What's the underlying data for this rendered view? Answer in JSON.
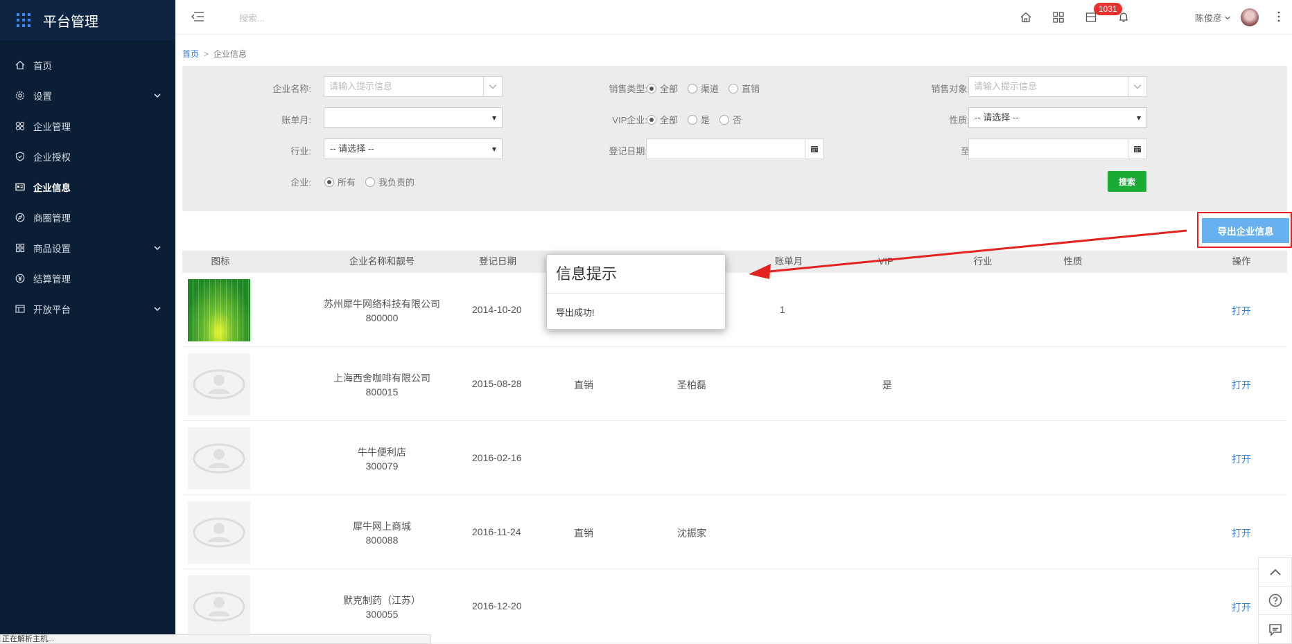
{
  "app": {
    "title": "平台管理"
  },
  "sidebar": {
    "items": [
      {
        "label": "首页",
        "icon": "home-icon"
      },
      {
        "label": "设置",
        "icon": "gear-icon",
        "expandable": true
      },
      {
        "label": "企业管理",
        "icon": "grid-icon"
      },
      {
        "label": "企业授权",
        "icon": "shield-icon"
      },
      {
        "label": "企业信息",
        "icon": "id-card-icon",
        "active": true
      },
      {
        "label": "商圈管理",
        "icon": "compass-icon"
      },
      {
        "label": "商品设置",
        "icon": "apps-icon",
        "expandable": true
      },
      {
        "label": "结算管理",
        "icon": "yen-icon"
      },
      {
        "label": "开放平台",
        "icon": "panel-icon",
        "expandable": true
      }
    ]
  },
  "topbar": {
    "search_placeholder": "搜索...",
    "badge_count": "1031",
    "user_name": "陈俊彦"
  },
  "breadcrumb": {
    "home": "首页",
    "separator": ">",
    "current": "企业信息"
  },
  "filters": {
    "company_name_label": "企业名称:",
    "company_name_placeholder": "请输入提示信息",
    "sales_type_label": "销售类型:",
    "sales_type_options": [
      "全部",
      "渠道",
      "直销"
    ],
    "sales_target_label": "销售对象:",
    "sales_target_placeholder": "请输入提示信息",
    "bill_month_label": "账单月:",
    "bill_month_value": "",
    "vip_label": "VIP企业:",
    "vip_options": [
      "全部",
      "是",
      "否"
    ],
    "nature_label": "性质:",
    "nature_value": "-- 请选择 --",
    "industry_label": "行业:",
    "industry_value": "-- 请选择 --",
    "reg_date_label": "登记日期:",
    "to_label": "至",
    "enterprise_label": "企业:",
    "enterprise_options": [
      "所有",
      "我负责的"
    ],
    "search_button": "搜索"
  },
  "export_button": "导出企业信息",
  "table": {
    "headers": [
      "图标",
      "企业名称和靓号",
      "登记日期",
      "",
      "",
      "账单月",
      "VIP",
      "行业",
      "性质",
      "操作"
    ],
    "rows": [
      {
        "name": "苏州犀牛网络科技有限公司",
        "code": "800000",
        "date": "2014-10-20",
        "sales_type": "",
        "sales_target": "",
        "bill_month": "1",
        "vip": "",
        "action": "打开",
        "thumb": "green"
      },
      {
        "name": "上海西舍咖啡有限公司",
        "code": "800015",
        "date": "2015-08-28",
        "sales_type": "直销",
        "sales_target": "圣柏磊",
        "bill_month": "",
        "vip": "是",
        "action": "打开",
        "thumb": "placeholder"
      },
      {
        "name": "牛牛便利店",
        "code": "300079",
        "date": "2016-02-16",
        "sales_type": "",
        "sales_target": "",
        "bill_month": "",
        "vip": "",
        "action": "打开",
        "thumb": "placeholder"
      },
      {
        "name": "犀牛网上商城",
        "code": "800088",
        "date": "2016-11-24",
        "sales_type": "直销",
        "sales_target": "沈振家",
        "bill_month": "",
        "vip": "",
        "action": "打开",
        "thumb": "placeholder"
      },
      {
        "name": "默克制药（江苏）",
        "code": "300055",
        "date": "2016-12-20",
        "sales_type": "",
        "sales_target": "",
        "bill_month": "",
        "vip": "",
        "action": "打开",
        "thumb": "placeholder"
      }
    ]
  },
  "modal": {
    "title": "信息提示",
    "message": "导出成功!"
  },
  "statusbar": "正在解析主机...",
  "colors": {
    "sidebar": "#0a1e36",
    "accent": "#2f7bd6",
    "search_green": "#1aab35",
    "export_blue": "#67b1f1",
    "highlight_red": "#e3231f",
    "badge_red": "#e8312f"
  }
}
